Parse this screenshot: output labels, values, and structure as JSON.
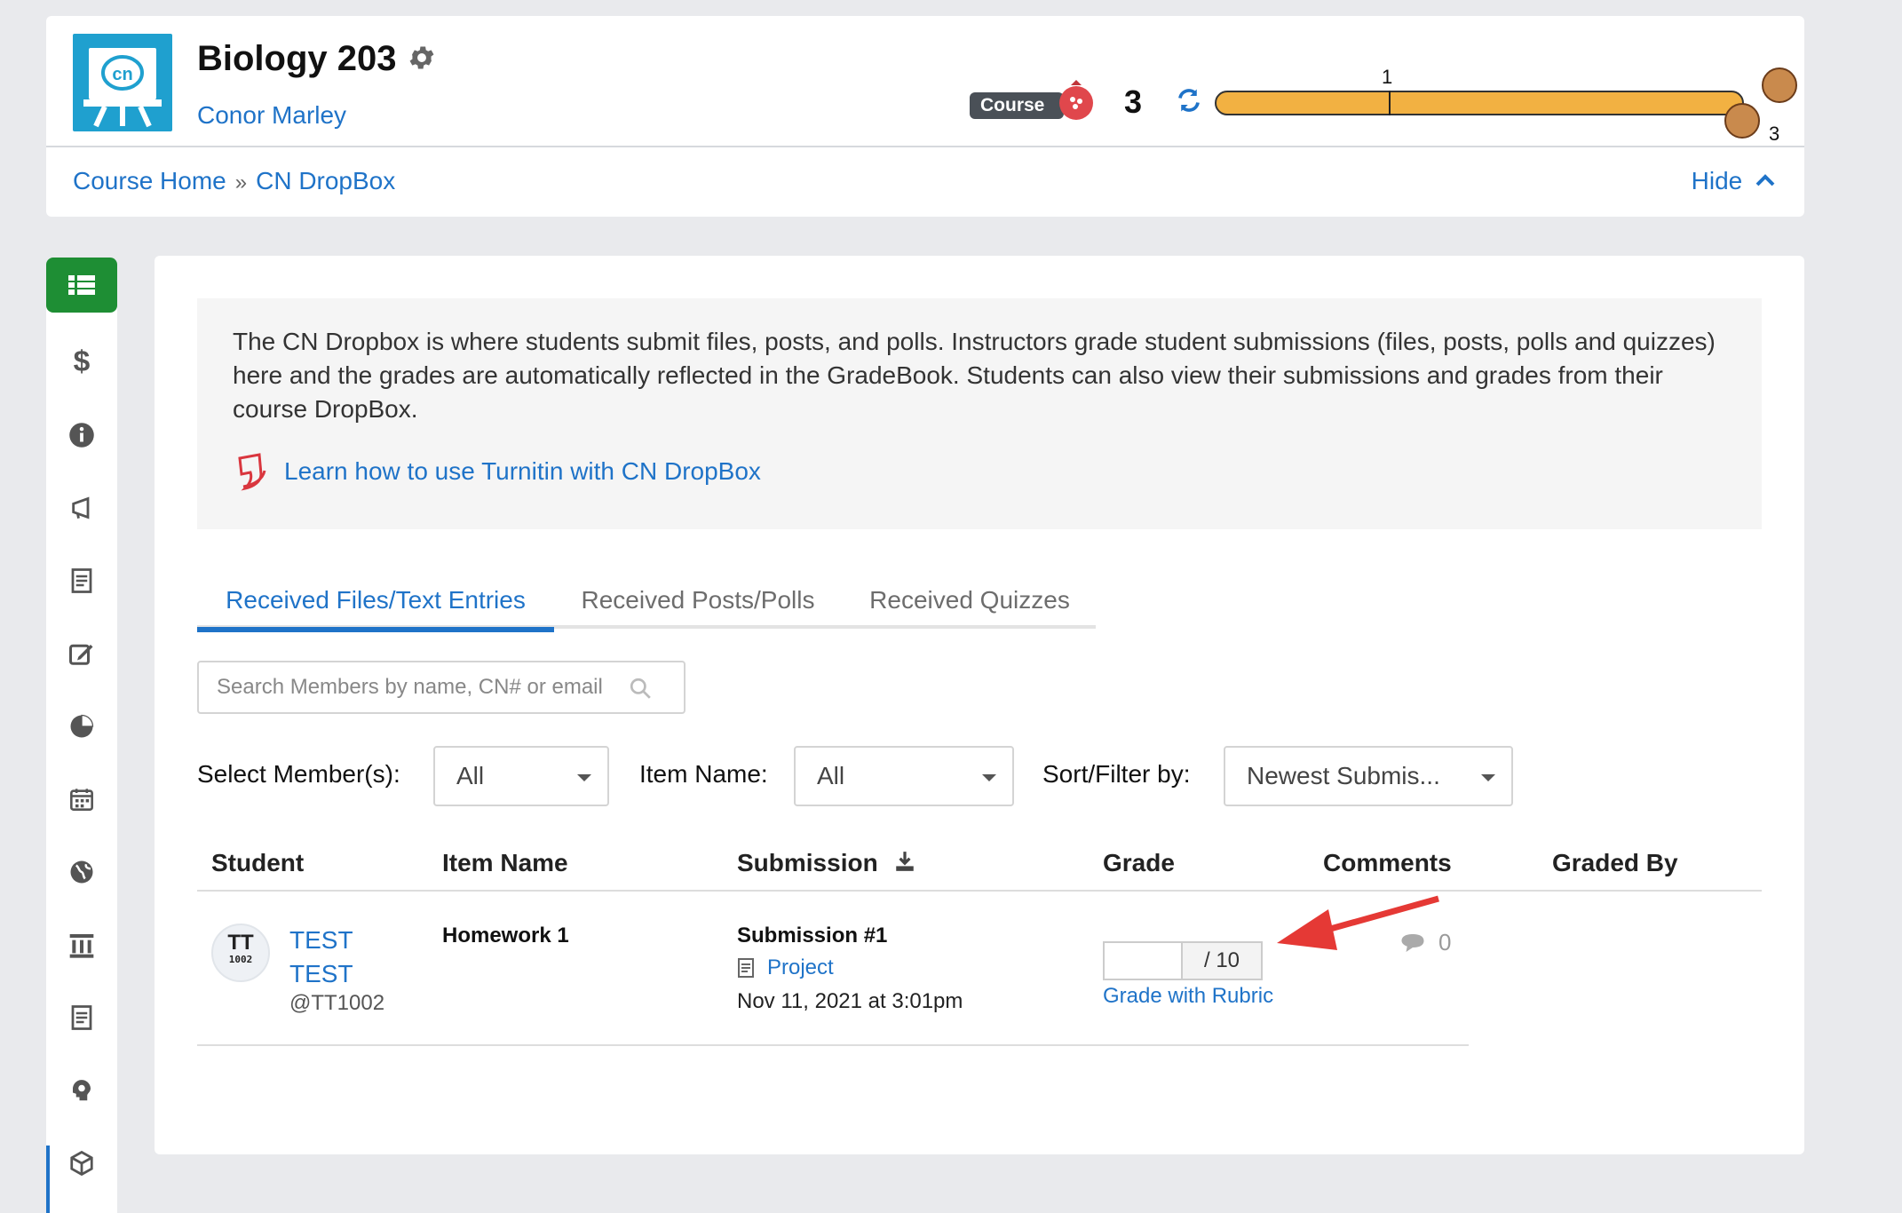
{
  "header": {
    "course_title": "Biology 203",
    "instructor": "Conor Marley",
    "badge_label": "Course",
    "badge_count": "3",
    "progress_label": "1",
    "progress_fraction": 0.33,
    "avatar_count": "3",
    "hide_label": "Hide"
  },
  "breadcrumb": {
    "home": "Course Home",
    "separator": "»",
    "current": "CN DropBox"
  },
  "info": {
    "description": "The CN Dropbox is where students submit files, posts, and polls. Instructors grade student submissions (files, posts, polls and quizzes) here and the grades are automatically reflected in the GradeBook. Students can also view their submissions and grades from their course DropBox.",
    "learn_link": "Learn how to use Turnitin with CN DropBox"
  },
  "tabs": [
    {
      "label": "Received Files/Text Entries",
      "active": true
    },
    {
      "label": "Received Posts/Polls",
      "active": false
    },
    {
      "label": "Received Quizzes",
      "active": false
    }
  ],
  "search": {
    "placeholder": "Search Members by name, CN# or email"
  },
  "filters": {
    "member_label": "Select Member(s):",
    "member_value": "All",
    "item_label": "Item Name:",
    "item_value": "All",
    "sort_label": "Sort/Filter by:",
    "sort_value": "Newest Submis..."
  },
  "table": {
    "headers": [
      "Student",
      "Item Name",
      "Submission",
      "Grade",
      "Comments",
      "Graded By"
    ],
    "rows": [
      {
        "initials": "TT",
        "id_small": "1002",
        "name": "TEST TEST",
        "handle": "@TT1002",
        "item_name": "Homework 1",
        "submission_title": "Submission #1",
        "submission_type": "Project",
        "submission_date": "Nov 11, 2021 at 3:01pm",
        "grade_value": "",
        "grade_max": "/ 10",
        "rubric_link": "Grade with Rubric",
        "comment_count": "0",
        "graded_by": ""
      }
    ]
  },
  "colors": {
    "accent": "#1f73c8",
    "nav_active": "#1e8e34",
    "progress": "#f2b142",
    "arrow": "#e53935",
    "logo": "#1fa0cf"
  }
}
